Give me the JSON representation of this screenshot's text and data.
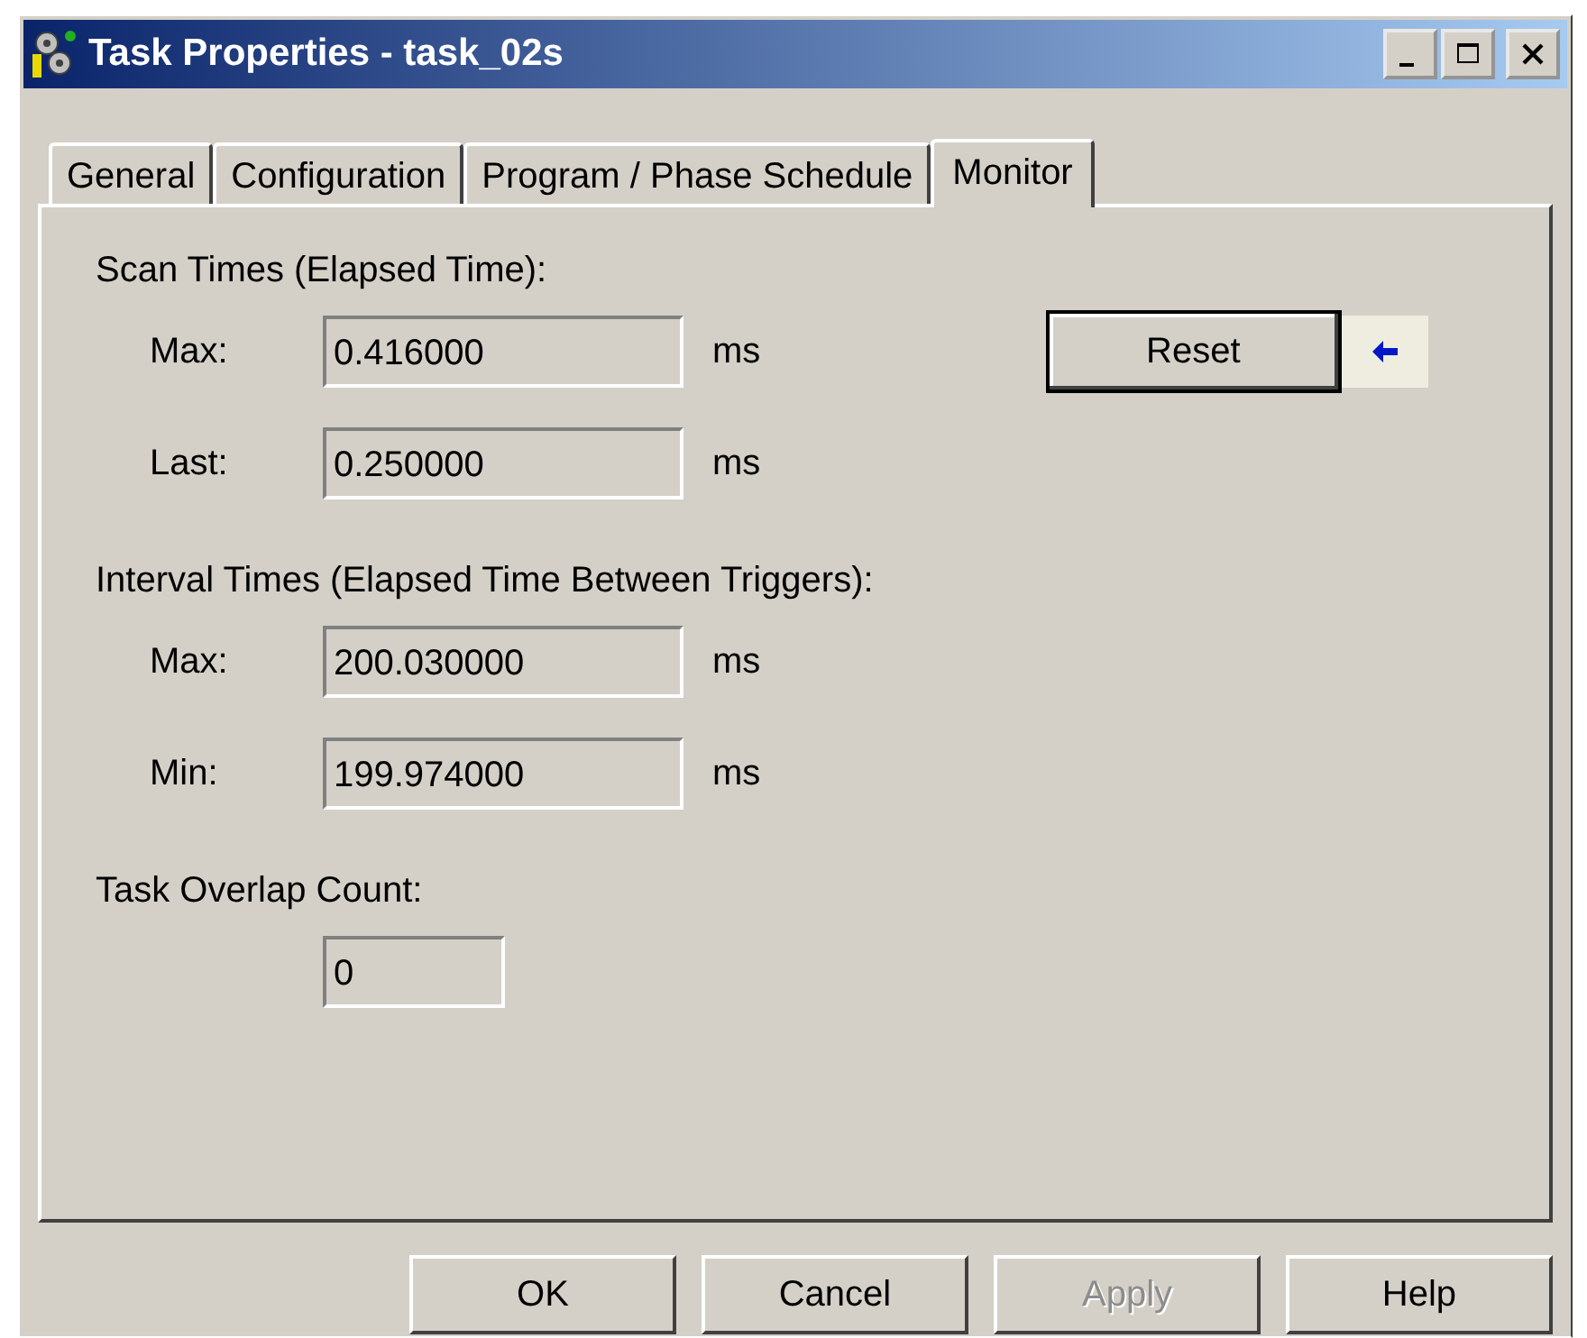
{
  "window": {
    "title": "Task Properties - task_02s"
  },
  "tabs": [
    {
      "label": "General",
      "selected": false
    },
    {
      "label": "Configuration",
      "selected": false
    },
    {
      "label": "Program / Phase Schedule",
      "selected": false
    },
    {
      "label": "Monitor",
      "selected": true
    }
  ],
  "sections": [
    {
      "title": "Scan Times (Elapsed Time):",
      "rows": [
        {
          "label": "Max:",
          "value": "0.416000",
          "unit": "ms"
        },
        {
          "label": "Last:",
          "value": "0.250000",
          "unit": "ms"
        }
      ]
    },
    {
      "title": "Interval Times (Elapsed Time Between Triggers):",
      "rows": [
        {
          "label": "Max:",
          "value": "200.030000",
          "unit": "ms"
        },
        {
          "label": "Min:",
          "value": "199.974000",
          "unit": "ms"
        }
      ]
    },
    {
      "title": "Task Overlap Count:",
      "rows": [
        {
          "value": "0"
        }
      ]
    }
  ],
  "reset_button": {
    "label": "Reset"
  },
  "buttons": [
    {
      "label": "OK",
      "disabled": false
    },
    {
      "label": "Cancel",
      "disabled": false
    },
    {
      "label": "Apply",
      "disabled": true
    },
    {
      "label": "Help",
      "disabled": false
    }
  ]
}
